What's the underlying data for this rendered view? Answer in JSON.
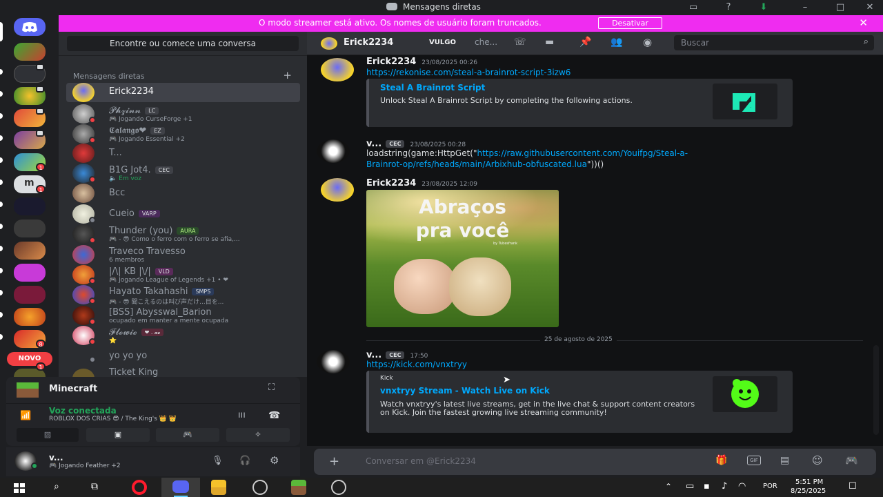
{
  "window": {
    "title": "Mensagens diretas"
  },
  "banner": {
    "text": "O modo streamer está ativo. Os nomes de usuário foram truncados.",
    "button": "Desativar"
  },
  "dm_list": {
    "search_placeholder": "Encontre ou comece uma conversa",
    "header": "Mensagens diretas",
    "items": [
      {
        "name": "Erick2234",
        "sub": "",
        "tag": "",
        "active": true
      },
      {
        "name": "𝓟𝓱𝔃𝓲𝓷𝓷",
        "tag": "LC",
        "sub": "🎮 Jogando CurseForge +1"
      },
      {
        "name": "𝕮𝖆𝖑𝖆𝖓𝖌𝖔❤",
        "tag": "EZ",
        "sub": "🎮 Jogando Essential +2"
      },
      {
        "name": "T...",
        "tag": "",
        "sub": ""
      },
      {
        "name": "B1G Jot4.",
        "tag": "CEC",
        "sub": "🔈 Em voz"
      },
      {
        "name": "Bcc",
        "tag": "",
        "sub": ""
      },
      {
        "name": "Cueio",
        "tag": "VARP",
        "sub": ""
      },
      {
        "name": "Thunder (you)",
        "tag": "AURA",
        "sub": "🎮 - 😎 Como o ferro com o ferro se afia,..."
      },
      {
        "name": "Traveco Travesso",
        "tag": "",
        "sub": "6 membros"
      },
      {
        "name": "|/\\| KB |\\/|",
        "tag": "VLD",
        "sub": "🎮 Jogando League of Legends +1 • ❤"
      },
      {
        "name": "Hayato Takahashi",
        "tag": "SMPS",
        "sub": "🎮 - 😎 聞こえるのは叫び声だけ...目を..."
      },
      {
        "name": "[BSS] Abysswal_Barion",
        "tag": "",
        "sub": "ocupado em manter a mente ocupada"
      },
      {
        "name": "𝓕𝓵𝓸𝔀𝓲𝓮",
        "tag": "❤ . 𝓪𝓮",
        "sub": "⭐"
      },
      {
        "name": "yo yo yo",
        "tag": "",
        "sub": ""
      },
      {
        "name": "Ticket King",
        "tag": "",
        "sub": ""
      }
    ]
  },
  "voice_panel": {
    "server": "Minecraft",
    "status": "Voz conectada",
    "channel": "ROBLOX DOS CRIAS 😎 / The King's 👑 👑"
  },
  "user_panel": {
    "name": "v...",
    "status": "🎮 Jogando Feather +2"
  },
  "chat_header": {
    "name": "Erick2234",
    "tag1": "VULGO",
    "tag2": "che...",
    "search": "Buscar"
  },
  "messages": [
    {
      "author": "Erick2234",
      "time": "23/08/2025 00:26",
      "link": "https://rekonise.com/steal-a-brainrot-script-3izw6",
      "embed": {
        "title": "Steal A Brainrot Script",
        "desc": "Unlock Steal A Brainrot Script by completing the following actions."
      }
    },
    {
      "author": "v...",
      "tag": "CEC",
      "time": "23/08/2025 00:28",
      "code_prefix": "loadstring(game:HttpGet(\"",
      "code_link": "https://raw.githubusercontent.com/Youifpg/Steal-a-",
      "code_link2": "Brainrot-op/refs/heads/main/Arbixhub-obfuscated.lua",
      "code_suffix": "\"))()"
    },
    {
      "author": "Erick2234",
      "time": "23/08/2025 12:09",
      "image_text1": "Abraços",
      "image_text2": "pra você",
      "image_small": "by Tubesfrank"
    },
    {
      "divider": "25 de agosto de 2025"
    },
    {
      "author": "v...",
      "tag": "CEC",
      "time": "17:50",
      "link": "https://kick.com/vnxtryy",
      "embed": {
        "provider": "Kick",
        "title": "vnxtryy Stream - Watch Live on Kick",
        "desc": "Watch vnxtryy's latest live streams, get in the live chat & support content creators on Kick. Join the fastest growing live streaming community!"
      }
    }
  ],
  "composer": {
    "placeholder": "Conversar em @Erick2234"
  },
  "taskbar": {
    "lang": "POR",
    "time": "5:51 PM",
    "date": "8/25/2025"
  },
  "servers": {
    "new_label": "NOVO"
  },
  "colors": {
    "accent": "#5865f2",
    "banner": "#ef2cf0",
    "link": "#00a8fc",
    "online": "#23a55a",
    "dnd": "#f23f43",
    "idle": "#f0b232"
  }
}
